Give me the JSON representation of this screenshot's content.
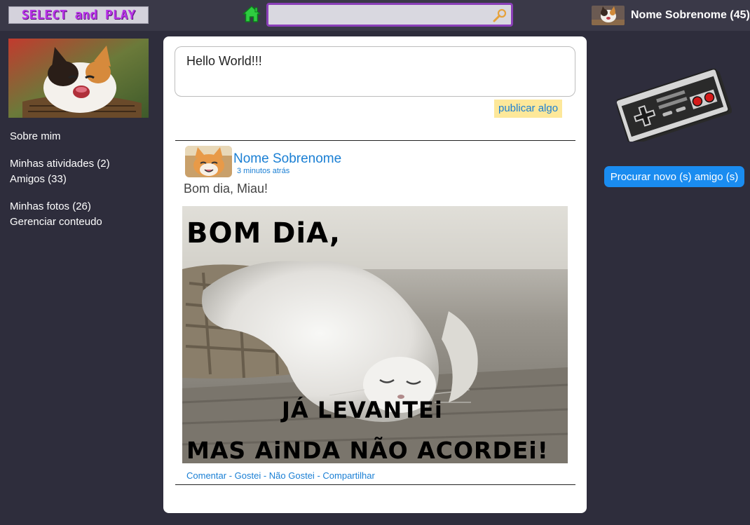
{
  "header": {
    "logo_text": "SELECT and PLAY",
    "search": {
      "value": "",
      "placeholder": ""
    },
    "user_name": "Nome Sobrenome (45)"
  },
  "sidebar": {
    "about": "Sobre mim",
    "activities": "Minhas atividades (2)",
    "friends": "Amigos (33)",
    "photos": "Minhas fotos (26)",
    "manage": "Gerenciar conteudo"
  },
  "composer": {
    "text": "Hello World!!!",
    "publish_label": "publicar algo"
  },
  "post": {
    "author": "Nome Sobrenome",
    "time": "3 minutos atrás",
    "text": "Bom dia, Miau!",
    "image_caption_top": "BOM DiA,",
    "image_caption_mid": "JÁ LEVANTEi",
    "image_caption_bottom": "MAS AiNDA NÃO ACORDEi!",
    "actions": {
      "comment": "Comentar",
      "like": "Gostei",
      "dislike": "Não Gostei",
      "share": "Compartilhar",
      "separator": " - "
    }
  },
  "right": {
    "find_friends_label": "Procurar novo (s) amigo (s)"
  },
  "colors": {
    "background": "#2e2d3c",
    "accent_blue": "#1a8cf0",
    "link_blue": "#1a7fd4",
    "logo_purple": "#b833e8",
    "home_green": "#2ecc40"
  },
  "icons": {
    "home": "home-icon",
    "search": "search-icon",
    "controller": "nes-controller-icon"
  }
}
